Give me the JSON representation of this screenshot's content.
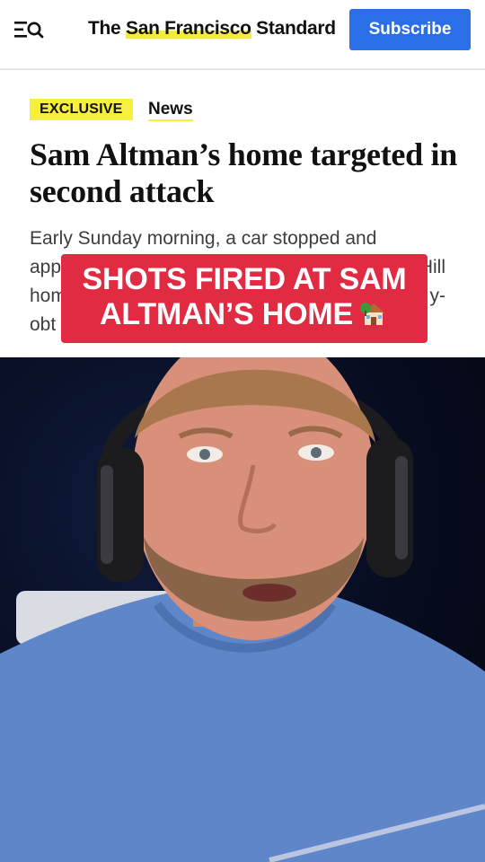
{
  "header": {
    "brand_prefix": "The ",
    "brand_highlight": "San Francisco",
    "brand_suffix": " Standard",
    "subscribe_label": "Subscribe",
    "menu_icon": "menu-search-icon"
  },
  "article": {
    "tag_exclusive": "EXCLUSIVE",
    "tag_news": "News",
    "headline": "Sam Altman’s home targeted in second attack",
    "excerpt_line1": "Early Sunday morning, a car stopped and",
    "excerpt_line2_start": "app",
    "excerpt_line2_end": "Hill",
    "excerpt_line3_start": "hom",
    "excerpt_line3_end": "y-",
    "excerpt_line4_start": "obt"
  },
  "overlay": {
    "caption_line1": "SHOTS FIRED AT SAM",
    "caption_line2": "ALTMAN’S HOME",
    "caption_icon": "house-icon"
  },
  "video": {
    "subject": "speaker-video"
  },
  "colors": {
    "subscribe": "#2a6ee8",
    "caption_bg": "#e12b43",
    "tag_highlight": "#f6ef3c"
  }
}
